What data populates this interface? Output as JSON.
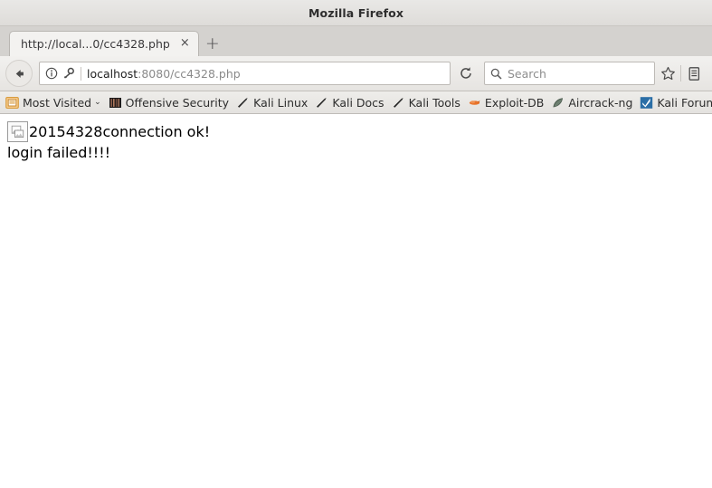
{
  "window": {
    "title": "Mozilla Firefox"
  },
  "tabs": {
    "items": [
      {
        "title": "http://local...0/cc4328.php",
        "close_label": "×"
      }
    ],
    "new_tab_label": "+"
  },
  "navbar": {
    "back_icon": "back-arrow-icon",
    "identity_icon": "info-icon",
    "permission_icon": "key-icon",
    "url_host": "localhost",
    "url_rest": ":8080/cc4328.php",
    "reload_icon": "reload-icon",
    "bookmark_icon": "star-icon",
    "library_icon": "library-icon"
  },
  "search": {
    "placeholder": "Search",
    "icon": "search-icon"
  },
  "bookmarks": {
    "items": [
      {
        "label": "Most Visited",
        "icon": "most-visited-icon",
        "has_chevron": true,
        "chevron": "⌄"
      },
      {
        "label": "Offensive Security",
        "icon": "offensive-security-icon",
        "has_chevron": false
      },
      {
        "label": "Kali Linux",
        "icon": "kali-icon",
        "has_chevron": false
      },
      {
        "label": "Kali Docs",
        "icon": "kali-icon",
        "has_chevron": false
      },
      {
        "label": "Kali Tools",
        "icon": "kali-icon",
        "has_chevron": false
      },
      {
        "label": "Exploit-DB",
        "icon": "exploit-db-icon",
        "has_chevron": false
      },
      {
        "label": "Aircrack-ng",
        "icon": "aircrack-icon",
        "has_chevron": false
      },
      {
        "label": "Kali Forums",
        "icon": "kali-forums-icon",
        "has_chevron": false
      }
    ]
  },
  "page": {
    "broken_image_icon": "broken-image-icon",
    "line1": "20154328connection ok!",
    "line2": "login failed!!!!"
  },
  "colors": {
    "chrome": "#e6e4e1",
    "tabstrip": "#d4d2cf",
    "page_background": "#ffffff",
    "text": "#000000",
    "url_host": "#1f1f1f",
    "url_rest": "#8a8a8a",
    "exploit_db_accent": "#e8732a",
    "kali_forums_accent": "#2a6ea6"
  }
}
